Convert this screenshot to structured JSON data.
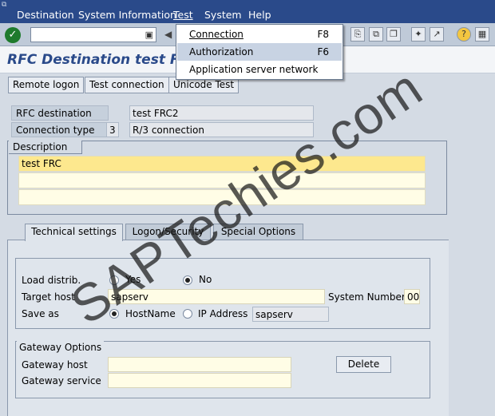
{
  "menubar": {
    "items": [
      {
        "label": "Destination"
      },
      {
        "label": "System Information"
      },
      {
        "label": "Test"
      },
      {
        "label": "System"
      },
      {
        "label": "Help"
      }
    ]
  },
  "test_menu": {
    "items": [
      {
        "label": "Connection",
        "shortcut": "F8"
      },
      {
        "label": "Authorization",
        "shortcut": "F6"
      },
      {
        "label": "Application server network",
        "shortcut": ""
      }
    ]
  },
  "toolbar": {
    "command_field": ""
  },
  "page": {
    "title": "RFC Destination test FRC2"
  },
  "app_toolbar": {
    "remote_logon": "Remote logon",
    "test_connection": "Test connection",
    "unicode_test": "Unicode Test"
  },
  "header": {
    "rfc_destination_label": "RFC destination",
    "rfc_destination_value": "test FRC2",
    "connection_type_label": "Connection type",
    "connection_type_code": "3",
    "connection_type_value": "R/3 connection"
  },
  "description": {
    "title": "Description",
    "lines": [
      "test FRC",
      "",
      ""
    ]
  },
  "tabs": [
    {
      "label": "Technical settings",
      "active": true
    },
    {
      "label": "Logon/Security",
      "active": false
    },
    {
      "label": "Special Options",
      "active": false
    }
  ],
  "technical": {
    "load_distrib_label": "Load distrib.",
    "yes_label": "Yes",
    "no_label": "No",
    "load_distrib_selected": "No",
    "target_host_label": "Target host",
    "target_host_value": "sapserv",
    "system_number_label": "System Number",
    "system_number_value": "00",
    "save_as_label": "Save as",
    "hostname_label": "HostName",
    "ip_label": "IP Address",
    "save_as_selected": "HostName",
    "save_as_value": "sapserv"
  },
  "gateway": {
    "title": "Gateway Options",
    "host_label": "Gateway host",
    "host_value": "",
    "service_label": "Gateway service",
    "service_value": "",
    "delete_label": "Delete"
  },
  "watermark": {
    "text": "SAPTechies.com"
  }
}
